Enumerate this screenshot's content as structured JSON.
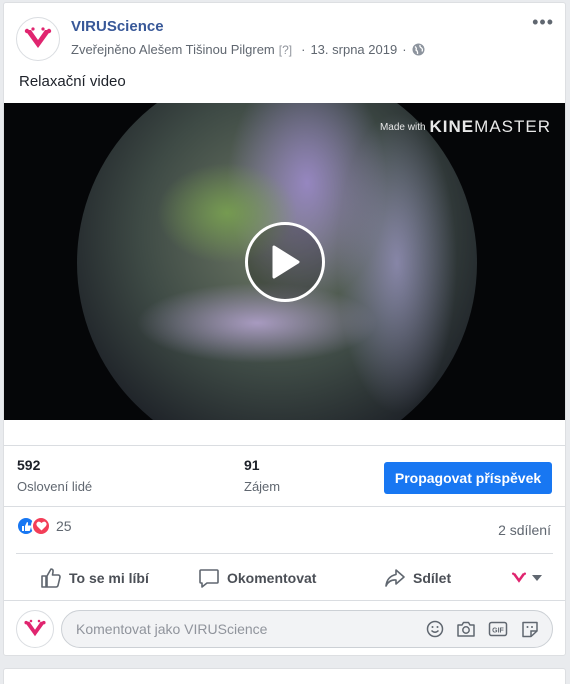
{
  "post": {
    "page_name": "VIRUScience",
    "published_by": "Zveřejněno Alešem Tišinou Pilgrem",
    "help_mark": "[?]",
    "date": "13. srpna 2019",
    "caption": "Relaxační video"
  },
  "video": {
    "watermark_prefix": "Made with",
    "watermark_brand_bold": "KINE",
    "watermark_brand_rest": "MASTER"
  },
  "insights": {
    "reach_count": "592",
    "reach_label": "Oslovení lidé",
    "engagement_count": "91",
    "engagement_label": "Zájem",
    "boost_label": "Propagovat příspěvek"
  },
  "reactions": {
    "count": "25",
    "shares": "2 sdílení",
    "types": [
      "like-icon",
      "love-icon"
    ],
    "colors": {
      "like": "#1877f2",
      "love": "#f33e58"
    }
  },
  "actions": {
    "like": "To se mi líbí",
    "comment": "Okomentovat",
    "share": "Sdílet"
  },
  "composer": {
    "placeholder": "Komentovat jako VIRUScience"
  },
  "colors": {
    "brand_logo": "#e0256f",
    "link": "#385898",
    "primary_button": "#1877f2"
  }
}
